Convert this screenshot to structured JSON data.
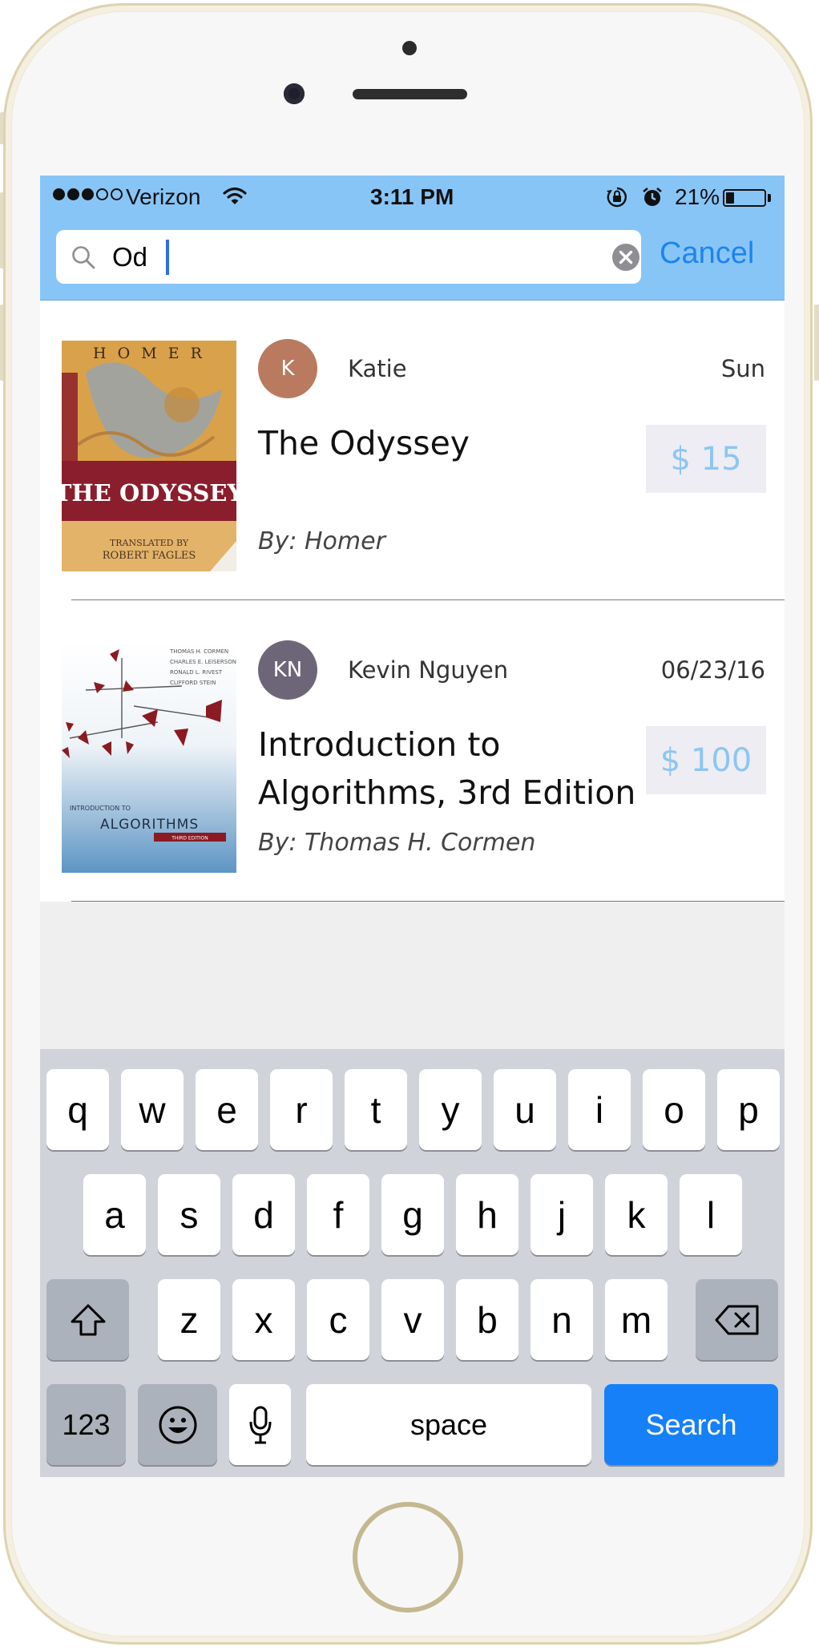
{
  "status_bar": {
    "carrier": "Verizon",
    "time": "3:11 PM",
    "battery_percent": "21%",
    "battery_level": 0.21,
    "signal_bars": 3,
    "icons": [
      "wifi-icon",
      "rotation-lock-icon",
      "alarm-icon",
      "battery-icon"
    ]
  },
  "search": {
    "query": "Od",
    "cancel_label": "Cancel",
    "icon": "search-icon"
  },
  "results": [
    {
      "seller_initials": "K",
      "seller_name": "Katie",
      "avatar_color": "#b97a5f",
      "date": "Sun",
      "title": "The Odyssey",
      "price": "$ 15",
      "author": "By: Homer",
      "cover": {
        "top_text": "H O M E R",
        "main_text": "THE ODYSSEY",
        "sub_text_1": "TRANSLATED BY",
        "sub_text_2": "ROBERT FAGLES",
        "colors": {
          "background": "#d9a24a",
          "band": "#8b1e2c"
        }
      }
    },
    {
      "seller_initials": "KN",
      "seller_name": "Kevin Nguyen",
      "avatar_color": "#6d6679",
      "date": "06/23/16",
      "title": "Introduction to Algorithms, 3rd Edition",
      "price": "$ 100",
      "author": "By: Thomas H. Cormen",
      "cover": {
        "authors": [
          "THOMAS H. CORMEN",
          "CHARLES E. LEISERSON",
          "RONALD L. RIVEST",
          "CLIFFORD STEIN"
        ],
        "small_title": "INTRODUCTION TO",
        "main_text": "ALGORITHMS",
        "edition": "THIRD EDITION",
        "colors": {
          "background": "#e8f0f6",
          "accent": "#8b1a22"
        }
      }
    }
  ],
  "keyboard": {
    "row1": [
      "q",
      "w",
      "e",
      "r",
      "t",
      "y",
      "u",
      "i",
      "o",
      "p"
    ],
    "row2": [
      "a",
      "s",
      "d",
      "f",
      "g",
      "h",
      "j",
      "k",
      "l"
    ],
    "row3": [
      "z",
      "x",
      "c",
      "v",
      "b",
      "n",
      "m"
    ],
    "numbers_label": "123",
    "space_label": "space",
    "search_label": "Search",
    "icons": [
      "shift-icon",
      "backspace-icon",
      "emoji-icon",
      "microphone-icon"
    ]
  },
  "colors": {
    "nav_background": "#88c5f7",
    "cancel": "#1d84f0",
    "price": "#8cc6f3",
    "search_key": "#1580f8"
  }
}
